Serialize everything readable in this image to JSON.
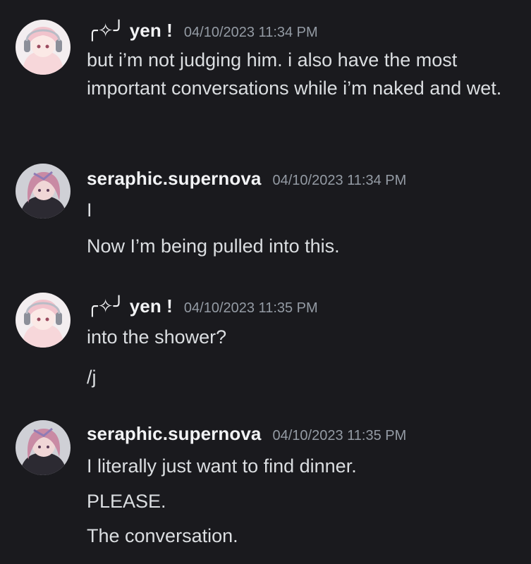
{
  "messages": [
    {
      "author": "╭✧╯ yen !",
      "timestamp": "04/10/2023 11:34 PM",
      "avatar_icon": "anime-girl-headphones-avatar",
      "lines": [
        "but i’m not judging him. i also have the most important conversations while i’m naked and wet."
      ]
    },
    {
      "author": "seraphic.supernova",
      "timestamp": "04/10/2023 11:34 PM",
      "avatar_icon": "anime-character-pink-hair-avatar",
      "lines": [
        "I",
        "Now I’m being pulled into this."
      ]
    },
    {
      "author": "╭✧╯ yen !",
      "timestamp": "04/10/2023 11:35 PM",
      "avatar_icon": "anime-girl-headphones-avatar",
      "lines": [
        "into the shower?",
        "/j"
      ]
    },
    {
      "author": "seraphic.supernova",
      "timestamp": "04/10/2023 11:35 PM",
      "avatar_icon": "anime-character-pink-hair-avatar",
      "lines": [
        "I literally just want to find dinner.",
        "PLEASE.",
        "The conversation."
      ]
    }
  ],
  "colors": {
    "background": "#1a1a1e",
    "username": "#f2f3f5",
    "timestamp": "#949ba4",
    "message_text": "#dbdee1"
  }
}
